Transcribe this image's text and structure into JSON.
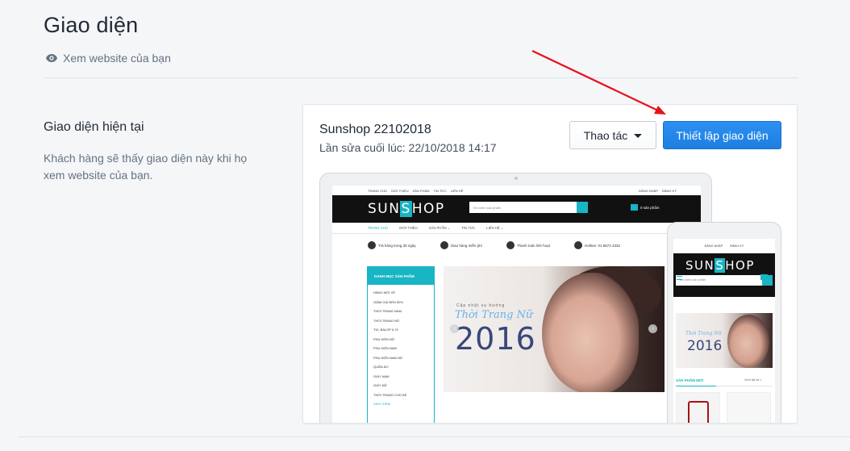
{
  "header": {
    "title": "Giao diện",
    "view_site": "Xem website của bạn",
    "view_site_icon": "eye-icon"
  },
  "section": {
    "title": "Giao diện hiện tại",
    "description": "Khách hàng sẽ thấy giao diện này khi họ xem website của bạn."
  },
  "theme": {
    "name": "Sunshop 22102018",
    "last_edited": "Lần sửa cuối lúc: 22/10/2018 14:17",
    "actions_label": "Thao tác",
    "customize_label": "Thiết lập giao diện"
  },
  "preview": {
    "top_links": [
      "TRANG CHỦ",
      "GIỚI THIỆU",
      "SẢN PHẨM",
      "TIN TỨC",
      "LIÊN HỆ"
    ],
    "account_links": [
      "ĐĂNG NHẬP",
      "ĐĂNG KÝ"
    ],
    "logo_prefix": "SUN",
    "logo_mark": "S",
    "logo_suffix": "HOP",
    "search_placeholder": "Tìm kiếm sản phẩm",
    "cart_label": "0 sản phẩm",
    "nav": [
      "TRANG CHỦ",
      "GIỚI THIỆU",
      "SẢN PHẨM ⌄",
      "TIN TỨC",
      "LIÊN HỆ ⌄"
    ],
    "features": [
      "Trả hàng trong 30 ngày",
      "Giao hàng miễn phí",
      "Thanh toán linh hoạt",
      "Hotline: 01 6674 2332"
    ],
    "category_title": "DANH MỤC SẢN PHẨM",
    "categories": [
      "HÀNG MỚI VỀ",
      "GIẢM GIÁ ĐẾN 50%",
      "THỜI TRANG NAM",
      "THỜI TRANG NỮ",
      "TÚI, BALOP & VÍ",
      "PHỤ KIỆN NỮ",
      "PHỤ KIỆN NAM",
      "PHỤ KIỆN NAM NỮ",
      "QUẦN ÁO",
      "GIÀY NAM",
      "GIÀY NỮ",
      "THỜI TRANG CHO BÉ",
      "XEM THÊM"
    ],
    "banner_small": "Cập nhật xu hướng",
    "banner_script": "Thời Trang Nữ",
    "banner_year": "2016",
    "mobile_new_products": "SẢN PHẨM MỚI",
    "mobile_view_all": "Xem tất cả »",
    "mobile_cart": "0"
  },
  "colors": {
    "accent": "#18b5c4",
    "primary_button": "#1d80e0",
    "annotation_arrow": "#e8101a"
  }
}
